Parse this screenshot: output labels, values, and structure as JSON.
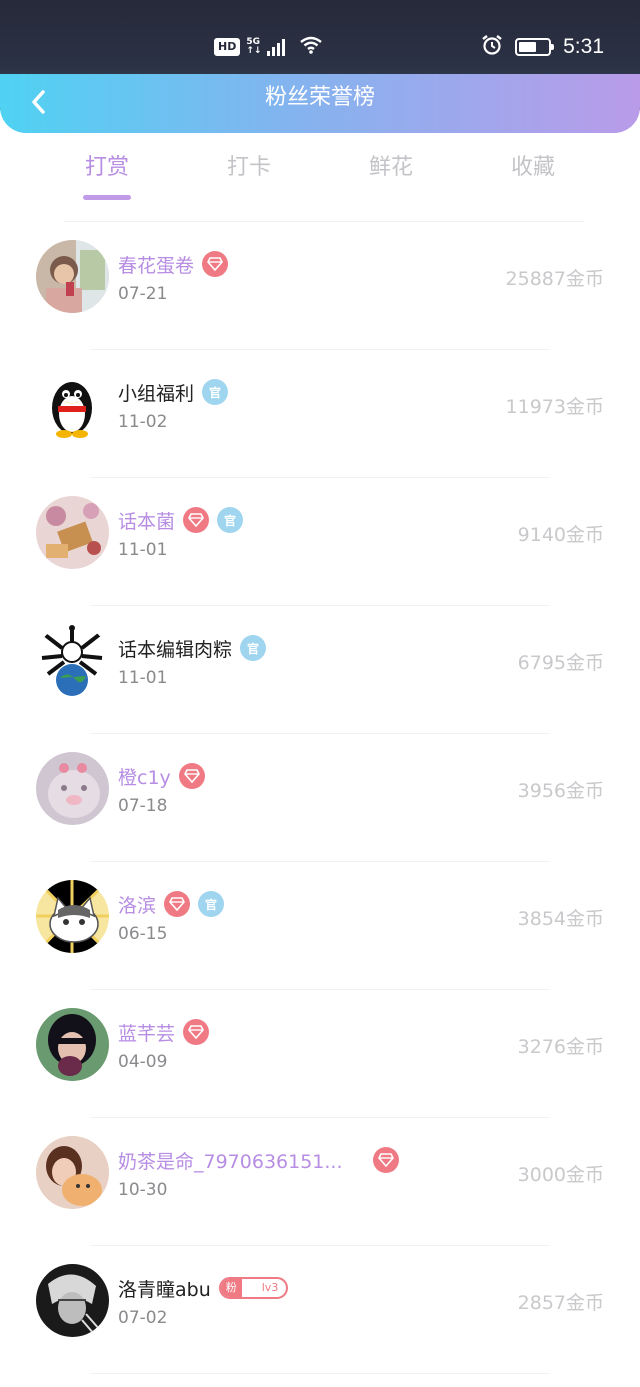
{
  "status_bar": {
    "hd": "HD",
    "network": "5G",
    "time": "5:31",
    "battery_level": 0.6
  },
  "header": {
    "title": "粉丝荣誉榜",
    "back_icon": "chevron-left-icon"
  },
  "tabs": [
    {
      "label": "打赏",
      "active": true
    },
    {
      "label": "打卡",
      "active": false
    },
    {
      "label": "鲜花",
      "active": false
    },
    {
      "label": "收藏",
      "active": false
    }
  ],
  "colors": {
    "accent_purple": "#b78ee3",
    "diamond_badge": "#ef7a84",
    "official_badge": "#9fd5ef",
    "header_gradient_start": "#4fd2f3",
    "header_gradient_end": "#b99be9"
  },
  "fans": [
    {
      "name": "春花蛋卷",
      "date": "07-21",
      "amount": "25887金币",
      "vip": true,
      "diamond": true,
      "official": false
    },
    {
      "name": "小组福利",
      "date": "11-02",
      "amount": "11973金币",
      "vip": false,
      "diamond": false,
      "official": true
    },
    {
      "name": "话本菌",
      "date": "11-01",
      "amount": "9140金币",
      "vip": true,
      "diamond": true,
      "official": true
    },
    {
      "name": "话本编辑肉粽",
      "date": "11-01",
      "amount": "6795金币",
      "vip": false,
      "diamond": false,
      "official": true
    },
    {
      "name": "橙c1y",
      "date": "07-18",
      "amount": "3956金币",
      "vip": true,
      "diamond": true,
      "official": false
    },
    {
      "name": "洛滨",
      "date": "06-15",
      "amount": "3854金币",
      "vip": true,
      "diamond": true,
      "official": true
    },
    {
      "name": "蓝芊芸",
      "date": "04-09",
      "amount": "3276金币",
      "vip": true,
      "diamond": true,
      "official": false
    },
    {
      "name": "奶茶是命_7970636151...",
      "date": "10-30",
      "amount": "3000金币",
      "vip": true,
      "diamond": true,
      "official": false
    },
    {
      "name": "洛青瞳abu",
      "date": "07-02",
      "amount": "2857金币",
      "vip": false,
      "diamond": false,
      "official": false,
      "fan_badge": {
        "left": "粉",
        "right": "lv3"
      }
    }
  ],
  "badges": {
    "official_text": "官"
  }
}
